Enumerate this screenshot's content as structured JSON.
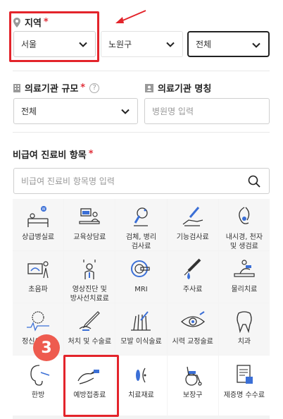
{
  "region": {
    "label": "지역",
    "required_mark": "*",
    "city": "서울",
    "district": "노원구",
    "scope": "전체"
  },
  "size": {
    "label": "의료기관 규모",
    "required_mark": "*",
    "help_glyph": "?",
    "value": "전체"
  },
  "name": {
    "label": "의료기관 명칭",
    "placeholder": "병원명 입력"
  },
  "items": {
    "label": "비급여 진료비 항목",
    "required_mark": "*",
    "search_placeholder": "비급여 진료비 항목명 입력",
    "categories": [
      {
        "label": "상급병실료",
        "icon": "hospital-bed-icon"
      },
      {
        "label": "교육상담료",
        "icon": "consultation-icon"
      },
      {
        "label": "검체, 병리\n검사료",
        "icon": "microscope-icon"
      },
      {
        "label": "기능검사료",
        "icon": "function-test-icon"
      },
      {
        "label": "내시경, 천자\n및 생검료",
        "icon": "endoscope-icon"
      },
      {
        "label": "초음파",
        "icon": "ultrasound-icon"
      },
      {
        "label": "영상진단 및\n방사선치료료",
        "icon": "radiology-icon"
      },
      {
        "label": "MRI",
        "icon": "mri-icon"
      },
      {
        "label": "주사료",
        "icon": "syringe-icon"
      },
      {
        "label": "물리치료",
        "icon": "physical-therapy-icon"
      },
      {
        "label": "정신요법료",
        "icon": "brain-wave-icon"
      },
      {
        "label": "처치 및 수술료",
        "icon": "scalpel-icon"
      },
      {
        "label": "모발 이식술료",
        "icon": "hair-transplant-icon"
      },
      {
        "label": "시력 교정술료",
        "icon": "eye-icon"
      },
      {
        "label": "치과",
        "icon": "tooth-icon"
      },
      {
        "label": "한방",
        "icon": "acupuncture-ear-icon"
      },
      {
        "label": "예방접종료",
        "icon": "vaccine-arm-icon"
      },
      {
        "label": "치료재료",
        "icon": "medical-material-icon"
      },
      {
        "label": "보장구",
        "icon": "wheelchair-icon"
      },
      {
        "label": "제증명 수수료",
        "icon": "certificate-icon"
      }
    ]
  },
  "step_badge": "3",
  "colors": {
    "highlight": "#e3242b",
    "required": "#e0303a",
    "badge": "#ee5b4f",
    "icon_blue": "#3b6fd6"
  }
}
